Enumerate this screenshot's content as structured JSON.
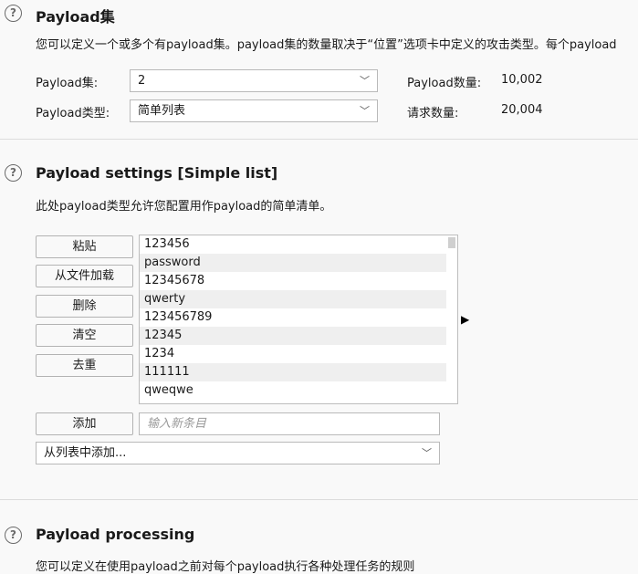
{
  "section1": {
    "title": "Payload集",
    "description": "您可以定义一个或多个有payload集。payload集的数量取决于“位置”选项卡中定义的攻击类型。每个payload",
    "payload_set_label": "Payload集:",
    "payload_set_value": "2",
    "payload_type_label": "Payload类型:",
    "payload_type_value": "简单列表",
    "payload_count_label": "Payload数量:",
    "payload_count_value": "10,002",
    "request_count_label": "请求数量:",
    "request_count_value": "20,004"
  },
  "section2": {
    "title": "Payload settings [Simple list]",
    "description": "此处payload类型允许您配置用作payload的简单清单。",
    "buttons": {
      "paste": "粘贴",
      "load": "从文件加载",
      "remove": "删除",
      "clear": "清空",
      "dedupe": "去重",
      "add": "添加"
    },
    "list_items": [
      "123456",
      "password",
      "12345678",
      "qwerty",
      "123456789",
      "12345",
      "1234",
      "111111",
      "qweqwe"
    ],
    "add_input_placeholder": "输入新条目",
    "add_from_list": "从列表中添加..."
  },
  "section3": {
    "title": "Payload processing",
    "description": "您可以定义在使用payload之前对每个payload执行各种处理任务的规则"
  },
  "icons": {
    "help": "?",
    "chevron": "﹀",
    "arrow": "▶"
  }
}
